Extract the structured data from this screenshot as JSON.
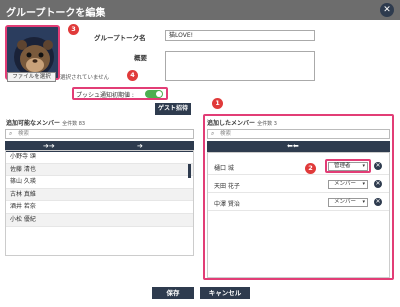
{
  "dialog": {
    "title": "グループトークを編集"
  },
  "avatar": {
    "file_button": "ファイルを選択",
    "file_status": "選択されていません"
  },
  "badges": [
    "1",
    "2",
    "3",
    "4"
  ],
  "form": {
    "name_label": "グループトーク名",
    "name_value": "猫LOVE!",
    "desc_label": "概要",
    "desc_value": "",
    "push_label": "プッシュ通知初期値 :",
    "push_on": true,
    "guest_button": "ゲスト招待"
  },
  "available": {
    "title": "追加可能なメンバー",
    "count": "全件数 83",
    "search_placeholder": "検索",
    "arrow_all": "➔➔",
    "arrow_one": "➔",
    "members": [
      "小野寺 頌",
      "佐藤 清也",
      "篠山 久瑛",
      "古林 真維",
      "酒井 若奈",
      "小松 優紀"
    ]
  },
  "added": {
    "title": "追加したメンバー",
    "count": "全件数 3",
    "search_placeholder": "検索",
    "arrow_back": "⬅⬅",
    "members": [
      {
        "name": "樋口 城",
        "role": "管理者"
      },
      {
        "name": "天田 花子",
        "role": "メンバー"
      },
      {
        "name": "中澤 賢治",
        "role": "メンバー"
      }
    ]
  },
  "footer": {
    "save": "保存",
    "cancel": "キャンセル"
  },
  "colors": {
    "navy": "#2e3b4e",
    "highlight": "#e23d76",
    "badge": "#e03a3a",
    "toggle_on": "#4caf50"
  },
  "icons": [
    "close-icon",
    "search-icon",
    "chevron-down-icon",
    "remove-icon",
    "double-arrow-right-icon",
    "arrow-right-icon",
    "double-arrow-left-icon"
  ]
}
